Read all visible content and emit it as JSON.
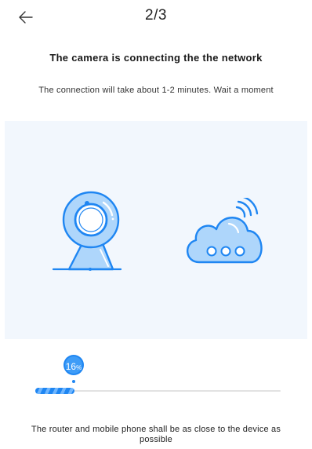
{
  "header": {
    "step": "2/3"
  },
  "title": "The camera is connecting the the network",
  "subtitle": "The connection will take about 1-2 minutes. Wait a moment",
  "progress": {
    "percent": 16,
    "value": "16",
    "unit": "%"
  },
  "tip": "The router and mobile phone shall be as close to the device as possible",
  "colors": {
    "accent": "#1f86f2",
    "illustration_bg": "#f2f7fd",
    "icon_fill": "#aed6fb"
  },
  "icons": {
    "back": "arrow-left-icon",
    "camera": "camera-icon",
    "cloud": "cloud-wifi-icon"
  }
}
